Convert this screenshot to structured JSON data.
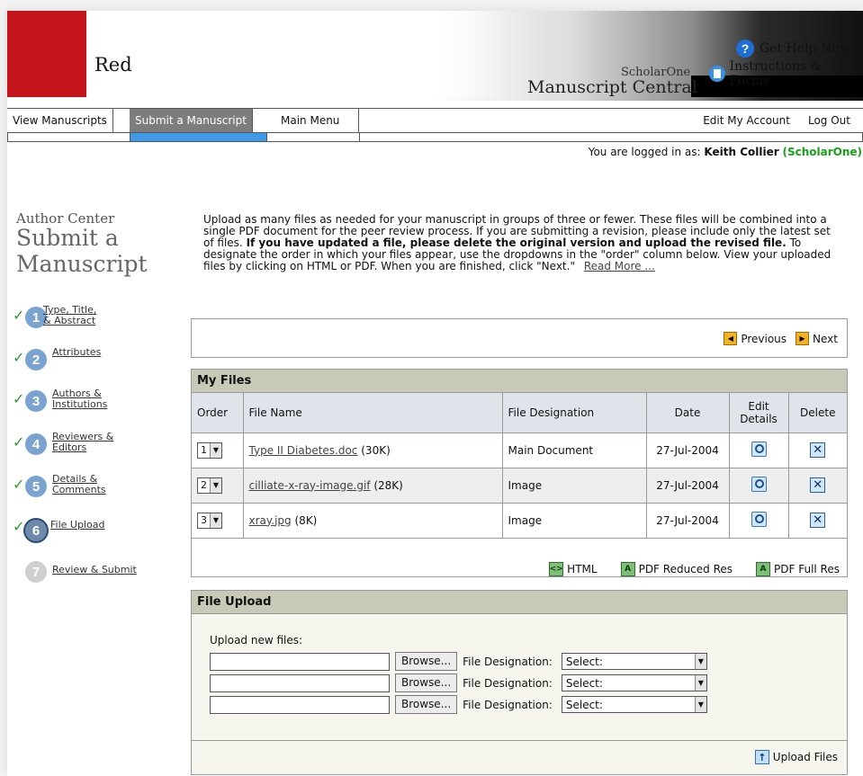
{
  "header": {
    "logo_text": "Red",
    "brand_small": "ScholarOne",
    "brand_large": "Manuscript Central",
    "help_label": "Get Help Now",
    "instructions_label": "Instructions & Forms",
    "accent_red": "#c2141a"
  },
  "nav": {
    "items": [
      "View Manuscripts",
      "Submit a Manuscript",
      "Main Menu"
    ],
    "active": "Submit a Manuscript",
    "edit_account": "Edit My Account",
    "logout": "Log Out"
  },
  "login": {
    "prefix": "You are logged in as:",
    "user": "Keith Collier",
    "org": "(ScholarOne)"
  },
  "sidebar": {
    "section": "Author Center",
    "title": "Submit a Manuscript",
    "steps": [
      {
        "num": "1",
        "label": "Type, Title, & Abstract",
        "done": true
      },
      {
        "num": "2",
        "label": "Attributes",
        "done": true
      },
      {
        "num": "3",
        "label": "Authors & Institutions",
        "done": true
      },
      {
        "num": "4",
        "label": "Reviewers & Editors",
        "done": true
      },
      {
        "num": "5",
        "label": "Details & Comments",
        "done": true
      },
      {
        "num": "6",
        "label": "File Upload",
        "done": true,
        "current": true
      },
      {
        "num": "7",
        "label": "Review & Submit",
        "done": false
      }
    ]
  },
  "intro": {
    "p1": "Upload as many files as needed for your manuscript in groups of three or fewer. These files will be combined into a single PDF document for the peer review process. If you are submitting a revision, please include only the latest set of files.",
    "bold": "If you have updated a file, please delete the original version and upload the revised file.",
    "p2": "To designate the order in which your files appear, use the dropdowns in the \"order\" column below. View your uploaded files by clicking on HTML or PDF. When you are finished, click \"Next.\"",
    "read_more": "Read More ..."
  },
  "pager": {
    "previous": "Previous",
    "next": "Next"
  },
  "my_files": {
    "title": "My Files",
    "columns": [
      "Order",
      "File Name",
      "File Designation",
      "Date",
      "Edit Details",
      "Delete"
    ],
    "rows": [
      {
        "order": "1",
        "name": "Type II Diabetes.doc",
        "size": "(30K)",
        "designation": "Main Document",
        "date": "27-Jul-2004"
      },
      {
        "order": "2",
        "name": "cilliate-x-ray-image.gif",
        "size": "(28K)",
        "designation": "Image",
        "date": "27-Jul-2004"
      },
      {
        "order": "3",
        "name": "xray.jpg",
        "size": "(8K)",
        "designation": "Image",
        "date": "27-Jul-2004"
      }
    ],
    "downloads": [
      "HTML",
      "PDF Reduced Res",
      "PDF Full Res"
    ]
  },
  "upload": {
    "title": "File Upload",
    "label": "Upload new files:",
    "browse": "Browse...",
    "designation_label": "File Designation:",
    "select_placeholder": "Select:",
    "button": "Upload Files"
  }
}
